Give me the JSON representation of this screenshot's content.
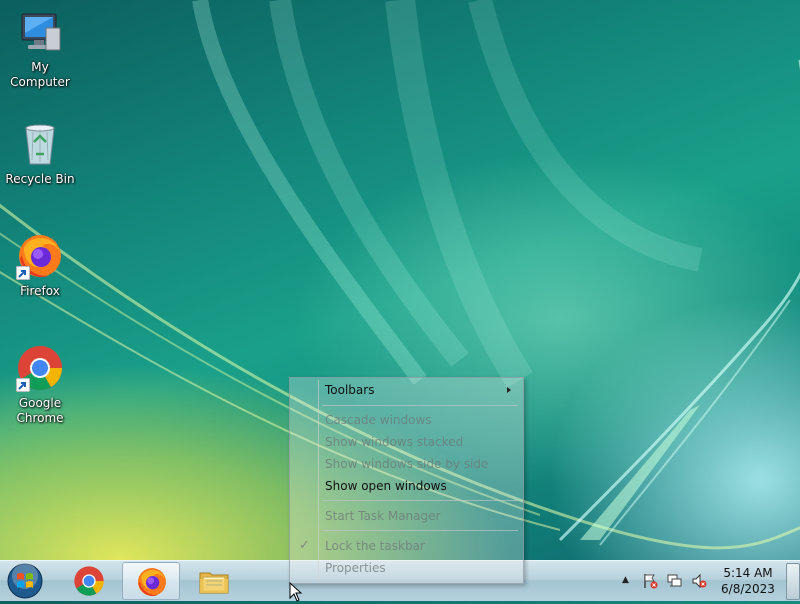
{
  "desktop": {
    "icons": [
      {
        "label": "My Computer"
      },
      {
        "label": "Recycle Bin"
      },
      {
        "label": "Firefox"
      },
      {
        "label": "Google\nChrome"
      }
    ]
  },
  "context_menu": {
    "items": [
      {
        "label": "Toolbars",
        "state": "enabled",
        "submenu": true
      },
      {
        "label": "Cascade windows",
        "state": "disabled"
      },
      {
        "label": "Show windows stacked",
        "state": "disabled"
      },
      {
        "label": "Show windows side by side",
        "state": "disabled"
      },
      {
        "label": "Show open windows",
        "state": "enabled"
      },
      {
        "label": "Start Task Manager",
        "state": "disabled"
      },
      {
        "label": "Lock the taskbar",
        "state": "disabled",
        "checked": true
      },
      {
        "label": "Properties",
        "state": "disabled"
      }
    ],
    "check_glyph": "✓"
  },
  "taskbar": {
    "pinned": [
      {
        "name": "chrome",
        "icon": "chrome-icon"
      },
      {
        "name": "firefox",
        "icon": "firefox-icon",
        "active": true
      },
      {
        "name": "explorer",
        "icon": "folder-icon"
      }
    ],
    "tray": {
      "up_arrow": "▲",
      "clock": {
        "time": "5:14 AM",
        "date": "6/8/2023"
      }
    }
  }
}
